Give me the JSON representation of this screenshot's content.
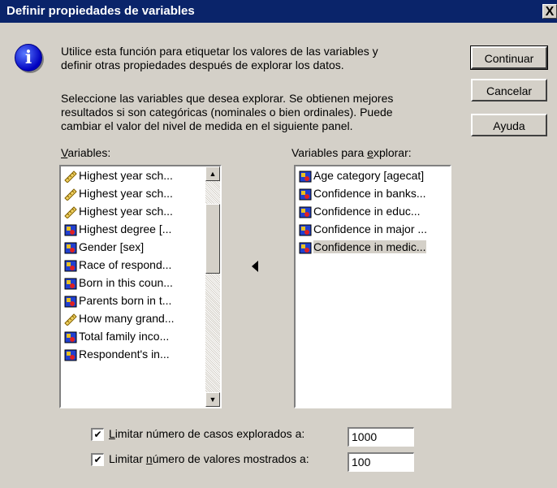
{
  "window": {
    "title": "Definir propiedades de variables",
    "close_label": "X"
  },
  "intro": {
    "line1": "Utilice esta función para etiquetar los valores de las variables y",
    "line2": "definir otras propiedades después de explorar los datos."
  },
  "instructions": {
    "line1": "Seleccione las variables que desea explorar. Se obtienen mejores",
    "line2": "resultados si son categóricas (nominales o bien ordinales). Puede",
    "line3": "cambiar el valor del nivel de medida en el siguiente panel."
  },
  "buttons": {
    "continue": "Continuar",
    "cancel": "Cancelar",
    "help": "Ayuda"
  },
  "variables_list": {
    "label_prefix": "",
    "label_mnemonic": "V",
    "label_rest": "ariables:",
    "items": [
      {
        "label": "Highest year sch...",
        "icon": "ruler-scale-icon"
      },
      {
        "label": "Highest year sch...",
        "icon": "ruler-scale-icon"
      },
      {
        "label": "Highest year sch...",
        "icon": "ruler-scale-icon"
      },
      {
        "label": "Highest degree [...",
        "icon": "nominal-variable-icon"
      },
      {
        "label": "Gender [sex]",
        "icon": "nominal-variable-icon"
      },
      {
        "label": "Race of respond...",
        "icon": "nominal-variable-icon"
      },
      {
        "label": "Born in this coun...",
        "icon": "nominal-variable-icon"
      },
      {
        "label": "Parents born in t...",
        "icon": "nominal-variable-icon"
      },
      {
        "label": "How many grand...",
        "icon": "ruler-scale-icon"
      },
      {
        "label": "Total family inco...",
        "icon": "nominal-variable-icon"
      },
      {
        "label": "Respondent's in...",
        "icon": "nominal-variable-icon"
      }
    ]
  },
  "explore_list": {
    "label_prefix": "Variables para ",
    "label_mnemonic": "e",
    "label_rest": "xplorar:",
    "items": [
      {
        "label": "Age category [agecat]",
        "icon": "nominal-variable-icon"
      },
      {
        "label": "Confidence in banks...",
        "icon": "nominal-variable-icon"
      },
      {
        "label": "Confidence in educ...",
        "icon": "nominal-variable-icon"
      },
      {
        "label": "Confidence in major ...",
        "icon": "nominal-variable-icon"
      },
      {
        "label": "Confidence in medic...",
        "icon": "nominal-variable-icon",
        "selected": true
      }
    ]
  },
  "limits": {
    "cases_prefix": "",
    "cases_mnemonic": "L",
    "cases_rest": "imitar número de casos explorados a:",
    "cases_checked": true,
    "cases_value": "1000",
    "values_prefix": "Limitar ",
    "values_mnemonic": "n",
    "values_rest": "úmero de valores mostrados a:",
    "values_checked": true,
    "values_value": "100"
  }
}
